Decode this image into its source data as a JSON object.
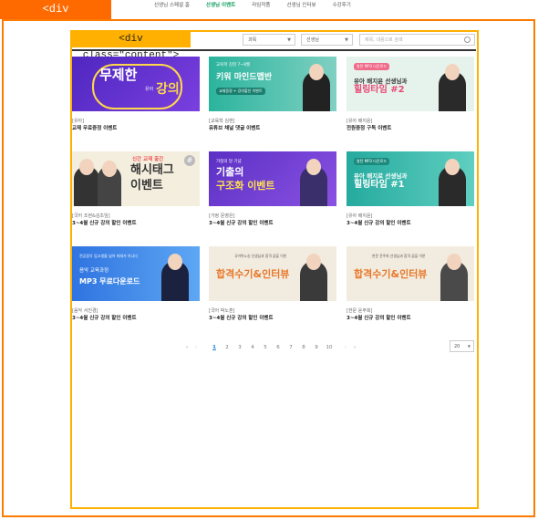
{
  "overlay": {
    "container_tag": "<div id=\"container\">",
    "content_tag": "<div class=\"content\">"
  },
  "topnav": {
    "items": [
      {
        "label": "선생님 스페셜 홈"
      },
      {
        "label": "선생님 이벤트"
      },
      {
        "label": "라임작품"
      },
      {
        "label": "선생님 인터뷰"
      },
      {
        "label": "수강후기"
      }
    ],
    "active_index": 1
  },
  "filters": {
    "subject_select": "과목",
    "teacher_select": "선생님",
    "search_placeholder": "제목, 내용으로 검색",
    "search_icon": "search-icon"
  },
  "cards": [
    {
      "category": "[유아]",
      "title": "교재 무료증정 이벤트",
      "banner": {
        "line1": "무제한",
        "line2": "강의",
        "badge": "유아",
        "bg": "#5a2fc6"
      }
    },
    {
      "category": "[교육학 김현]",
      "title": "유튜브 채널 댓글 이벤트",
      "banner": {
        "small": "교육학 김현 7~8월",
        "line1": "키워 마인드맵반",
        "pill": "교재증정 + 강의할인 이벤트",
        "bg": "#2db8a0"
      }
    },
    {
      "category": "[유아 배지윤]",
      "title": "전원증정 구독 이벤트",
      "banner": {
        "pill": "왕된 MP3 다운로드",
        "line1": "유아 배지윤 선생님과",
        "line2": "힐링타임 #2",
        "bg": "#e9f3ee"
      }
    },
    {
      "category": "[국어 조현&김초임]",
      "title": "3~4월 신규 강의 할인 이벤트",
      "banner": {
        "small": "신간 교재 출간",
        "line1": "해시태그",
        "line2": "이벤트",
        "bg": "#f4eede"
      }
    },
    {
      "category": "[가정 문영은]",
      "title": "3~4월 신규 강의 할인 이벤트",
      "banner": {
        "small": "가정의 달 기념",
        "line1": "기출의",
        "line2": "구조화 이벤트",
        "bg": "#6b3fc9"
      }
    },
    {
      "category": "[유아 배지윤]",
      "title": "3~4월 신규 강의 할인 이벤트",
      "banner": {
        "pill": "왕된 MP3 다운로드",
        "line1": "유아 배지로 선생님과",
        "line2": "힐링타임 #1",
        "bg": "#2eb7a8"
      }
    },
    {
      "category": "[음악 서진경]",
      "title": "3~4월 신규 강의 할인 이벤트",
      "banner": {
        "small": "전공음악 임고생을 넘어 미래가 아니다",
        "line1": "음악 교육과정",
        "line2": "MP3 무료다운로드",
        "bg": "#3b84e8"
      }
    },
    {
      "category": "[국어 박노훈]",
      "title": "3~4월 신규 강의 할인 이벤트",
      "banner": {
        "small": "국어박노승 선생님과 합격 꿈을 이룬",
        "line1": "합격수기&인터뷰",
        "bg": "#f2ece0"
      }
    },
    {
      "category": "[한문 윤주희]",
      "title": "3~4월 신규 강의 할인 이벤트",
      "banner": {
        "small": "한문 윤주희 선생님과 합격 꿈을 이룬",
        "line1": "합격수기&인터뷰",
        "bg": "#f2ece0"
      }
    }
  ],
  "pagination": {
    "first": "«",
    "prev": "‹",
    "pages": [
      "1",
      "2",
      "3",
      "4",
      "5",
      "6",
      "7",
      "8",
      "9",
      "10"
    ],
    "current": "1",
    "next": "›",
    "last": "»",
    "page_size": "20"
  }
}
